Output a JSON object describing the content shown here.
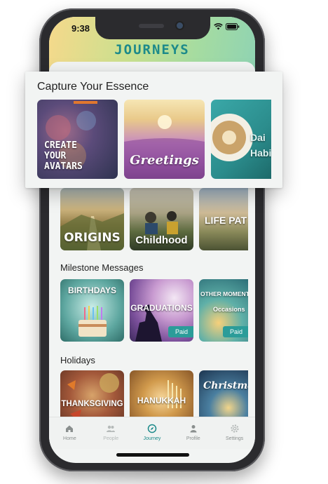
{
  "status_bar": {
    "time": "9:38"
  },
  "app_title": "JOURNEYS",
  "popup": {
    "title": "Capture Your Essence",
    "cards": [
      {
        "label": "CREATE YOUR AVATARS",
        "line1": "CREATE",
        "line2": "YOUR",
        "line3": "AVATARS"
      },
      {
        "label": "Greetings"
      },
      {
        "label": "Daily Habits",
        "visible_text_1": "Dai",
        "visible_text_2": "Habi"
      }
    ]
  },
  "sections": [
    {
      "title": "",
      "cards": [
        {
          "label": "ORIGINS"
        },
        {
          "label": "Childhood"
        },
        {
          "label": "LIFE PAT"
        }
      ]
    },
    {
      "title": "Milestone Messages",
      "cards": [
        {
          "label": "BIRTHDAYS"
        },
        {
          "label": "GRADUATIONS",
          "badge": "Paid"
        },
        {
          "label_line1": "OTHER MOMENT",
          "label_line2": "Occasions",
          "badge": "Paid"
        }
      ]
    },
    {
      "title": "Holidays",
      "cards": [
        {
          "label": "THANKSGIVING"
        },
        {
          "label": "HANUKKAH"
        },
        {
          "label": "Christmas"
        }
      ]
    }
  ],
  "tabbar": [
    {
      "label": "Home",
      "icon": "home-icon",
      "active": false
    },
    {
      "label": "People",
      "icon": "people-icon",
      "active": false
    },
    {
      "label": "Journey",
      "icon": "compass-icon",
      "active": true
    },
    {
      "label": "Profile",
      "icon": "profile-icon",
      "active": false
    },
    {
      "label": "Settings",
      "icon": "gear-icon",
      "active": false
    }
  ],
  "colors": {
    "accent": "#1c8a8a",
    "badge": "#2b9c99"
  }
}
